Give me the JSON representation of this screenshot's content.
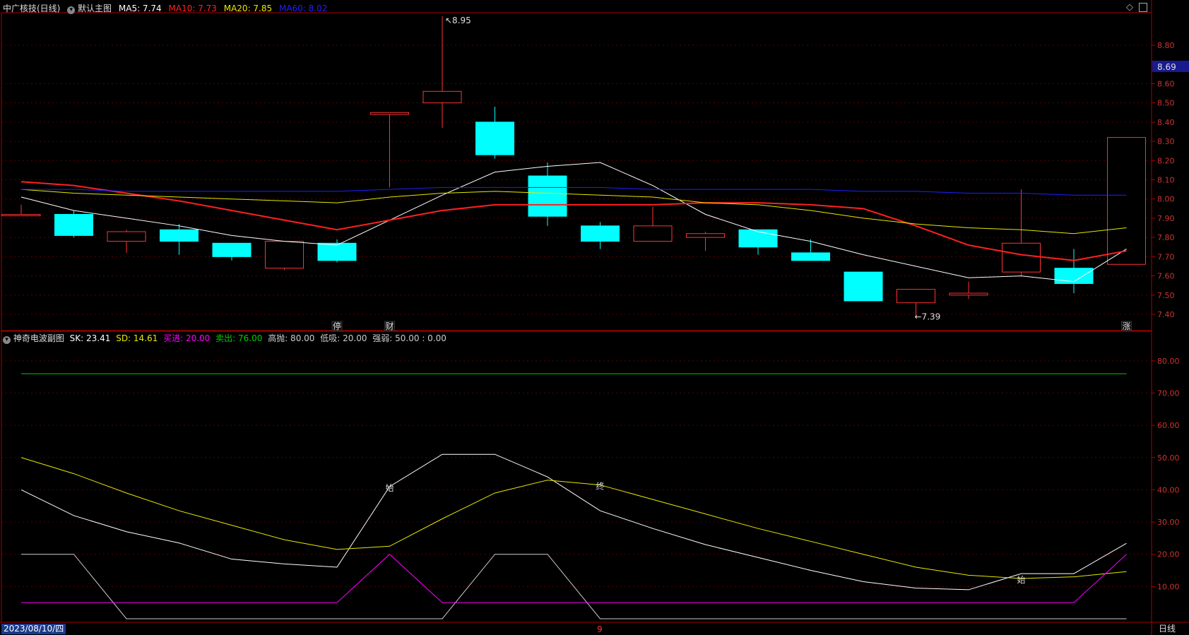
{
  "main_header": {
    "title": "中广核技(日线)",
    "chart_name": "默认主图",
    "ma5_label": "MA5: 7.74",
    "ma10_label": "MA10: 7.73",
    "ma20_label": "MA20: 7.85",
    "ma60_label": "MA60: 8.02"
  },
  "sub_header": {
    "chart_name": "神奇电波副图",
    "sk_label": "SK: 23.41",
    "sd_label": "SD: 14.61",
    "buy_label": "买进: 20.00",
    "sell_label": "卖出: 76.00",
    "high_label": "高抛: 80.00",
    "low_label": "低吸: 20.00",
    "strength_label": "强弱: 50.00 : 0.00"
  },
  "bottom_bar": {
    "date_label": "2023/08/10/四",
    "month_marker": "9",
    "period_label": "日线"
  },
  "colors": {
    "up": "#ff3333",
    "down": "#00ffff",
    "ma5": "#ffffff",
    "ma10": "#ff2020",
    "ma20": "#e8e800",
    "ma60": "#2020ff",
    "sk": "#ffffff",
    "sd": "#e8e800",
    "buy": "#ff00ff",
    "sell": "#00cc00",
    "axis": "#aa0000"
  },
  "chart_data": [
    {
      "type": "candlestick",
      "title": "中广核技(日线)",
      "ylim": [
        7.34,
        9.0
      ],
      "y_ticks": [
        "7.40",
        "7.50",
        "7.60",
        "7.70",
        "7.80",
        "7.90",
        "8.00",
        "8.10",
        "8.20",
        "8.30",
        "8.40",
        "8.50",
        "8.60",
        "8.80"
      ],
      "current_price_label": "8.69",
      "high_annotation": "8.95",
      "low_annotation": "7.39",
      "event_markers": [
        "停",
        "财",
        "涨"
      ],
      "candles": [
        {
          "o": 7.92,
          "h": 7.97,
          "l": 7.92,
          "c": 7.92
        },
        {
          "o": 7.92,
          "h": 7.94,
          "l": 7.8,
          "c": 7.81
        },
        {
          "o": 7.78,
          "h": 7.84,
          "l": 7.72,
          "c": 7.83
        },
        {
          "o": 7.84,
          "h": 7.87,
          "l": 7.71,
          "c": 7.78
        },
        {
          "o": 7.77,
          "h": 7.77,
          "l": 7.68,
          "c": 7.7
        },
        {
          "o": 7.64,
          "h": 7.78,
          "l": 7.63,
          "c": 7.78
        },
        {
          "o": 7.77,
          "h": 7.79,
          "l": 7.67,
          "c": 7.68
        },
        {
          "o": 8.44,
          "h": 8.45,
          "l": 8.06,
          "c": 8.45
        },
        {
          "o": 8.5,
          "h": 8.95,
          "l": 8.37,
          "c": 8.56
        },
        {
          "o": 8.4,
          "h": 8.48,
          "l": 8.21,
          "c": 8.23
        },
        {
          "o": 8.12,
          "h": 8.19,
          "l": 7.86,
          "c": 7.91
        },
        {
          "o": 7.86,
          "h": 7.88,
          "l": 7.74,
          "c": 7.78
        },
        {
          "o": 7.78,
          "h": 7.96,
          "l": 7.78,
          "c": 7.86
        },
        {
          "o": 7.8,
          "h": 7.83,
          "l": 7.73,
          "c": 7.82
        },
        {
          "o": 7.84,
          "h": 7.84,
          "l": 7.71,
          "c": 7.75
        },
        {
          "o": 7.72,
          "h": 7.79,
          "l": 7.68,
          "c": 7.68
        },
        {
          "o": 7.62,
          "h": 7.62,
          "l": 7.47,
          "c": 7.47
        },
        {
          "o": 7.46,
          "h": 7.53,
          "l": 7.39,
          "c": 7.53
        },
        {
          "o": 7.5,
          "h": 7.57,
          "l": 7.48,
          "c": 7.51
        },
        {
          "o": 7.62,
          "h": 8.05,
          "l": 7.6,
          "c": 7.77
        },
        {
          "o": 7.64,
          "h": 7.74,
          "l": 7.51,
          "c": 7.56
        },
        {
          "o": 7.66,
          "h": 8.32,
          "l": 7.66,
          "c": 8.32
        }
      ],
      "series": [
        {
          "name": "MA5",
          "values": [
            8.01,
            7.94,
            7.9,
            7.86,
            7.81,
            7.78,
            7.76,
            7.89,
            8.02,
            8.14,
            8.17,
            8.19,
            8.07,
            7.92,
            7.83,
            7.78,
            7.71,
            7.65,
            7.59,
            7.6,
            7.57,
            7.74
          ]
        },
        {
          "name": "MA10",
          "values": [
            8.09,
            8.07,
            8.03,
            7.99,
            7.94,
            7.89,
            7.84,
            7.89,
            7.94,
            7.97,
            7.97,
            7.97,
            7.97,
            7.98,
            7.98,
            7.97,
            7.95,
            7.86,
            7.76,
            7.71,
            7.68,
            7.73
          ]
        },
        {
          "name": "MA20",
          "values": [
            8.05,
            8.03,
            8.02,
            8.01,
            8.0,
            7.99,
            7.98,
            8.01,
            8.03,
            8.04,
            8.03,
            8.02,
            8.01,
            7.98,
            7.97,
            7.94,
            7.9,
            7.87,
            7.85,
            7.84,
            7.82,
            7.85
          ]
        },
        {
          "name": "MA60",
          "values": [
            8.05,
            8.05,
            8.04,
            8.04,
            8.04,
            8.04,
            8.04,
            8.05,
            8.06,
            8.06,
            8.06,
            8.06,
            8.05,
            8.05,
            8.05,
            8.05,
            8.04,
            8.04,
            8.03,
            8.03,
            8.02,
            8.02
          ]
        }
      ]
    },
    {
      "type": "line",
      "title": "神奇电波副图",
      "ylim": [
        0,
        85
      ],
      "y_ticks": [
        "10.00",
        "20.00",
        "30.00",
        "40.00",
        "50.00",
        "60.00",
        "70.00",
        "80.00"
      ],
      "annotations": [
        {
          "text": "始",
          "series": "SK",
          "index": 7
        },
        {
          "text": "终",
          "series": "SD",
          "index": 11
        },
        {
          "text": "始",
          "series": "SD",
          "index": 19
        }
      ],
      "series": [
        {
          "name": "SK",
          "values": [
            40,
            32,
            27,
            23.5,
            18.5,
            17,
            16,
            41,
            51,
            51,
            44,
            33.5,
            28,
            23,
            19,
            15,
            11.5,
            9.5,
            9,
            14,
            14,
            23.41
          ]
        },
        {
          "name": "SD",
          "values": [
            50,
            45,
            39,
            33.5,
            29,
            24.5,
            21.5,
            22.5,
            31,
            39,
            43,
            41.5,
            37,
            32.5,
            28,
            24,
            20,
            16,
            13.5,
            12.5,
            13,
            14.61
          ]
        },
        {
          "name": "aux",
          "values": [
            20,
            20,
            0,
            0,
            0,
            0,
            0,
            0,
            0,
            20,
            20,
            0,
            0,
            0,
            0,
            0,
            0,
            0,
            0,
            0,
            0,
            0
          ]
        },
        {
          "name": "买进",
          "values": [
            5,
            5,
            5,
            5,
            5,
            5,
            5,
            20,
            5,
            5,
            5,
            5,
            5,
            5,
            5,
            5,
            5,
            5,
            5,
            5,
            5,
            20
          ]
        },
        {
          "name": "卖出",
          "values": [
            76,
            76,
            76,
            76,
            76,
            76,
            76,
            76,
            76,
            76,
            76,
            76,
            76,
            76,
            76,
            76,
            76,
            76,
            76,
            76,
            76,
            76
          ]
        }
      ]
    }
  ]
}
